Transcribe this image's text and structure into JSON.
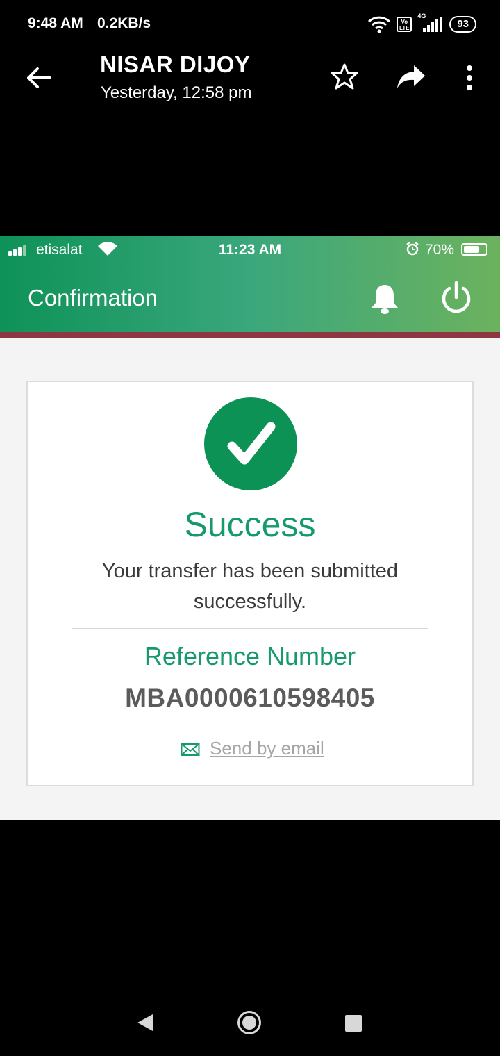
{
  "status_bar": {
    "time": "9:48 AM",
    "speed": "0.2KB/s",
    "network": "4G",
    "volte": "Vo LTE",
    "battery": "93",
    "icons": [
      "wifi-icon",
      "volte-icon",
      "signal-icon",
      "battery-icon"
    ]
  },
  "viewer": {
    "sender": "NISAR DIJOY",
    "date": "Yesterday, 12:58 pm",
    "icons": [
      "back-arrow-icon",
      "star-icon",
      "share-icon",
      "more-vert-icon"
    ]
  },
  "inner_status_bar": {
    "carrier": "etisalat",
    "time": "11:23 AM",
    "battery": "70%"
  },
  "app": {
    "title": "Confirmation",
    "icons": [
      "bell-icon",
      "power-icon"
    ]
  },
  "card": {
    "status": "Success",
    "message_line1": "Your transfer has been submitted",
    "message_line2": "successfully.",
    "ref_label": "Reference Number",
    "ref_value": "MBA0000610598405",
    "email_link": "Send by email"
  },
  "colors": {
    "accent_green": "#0c9254",
    "text_green": "#169a6b",
    "header_stripe": "#8e3641"
  }
}
